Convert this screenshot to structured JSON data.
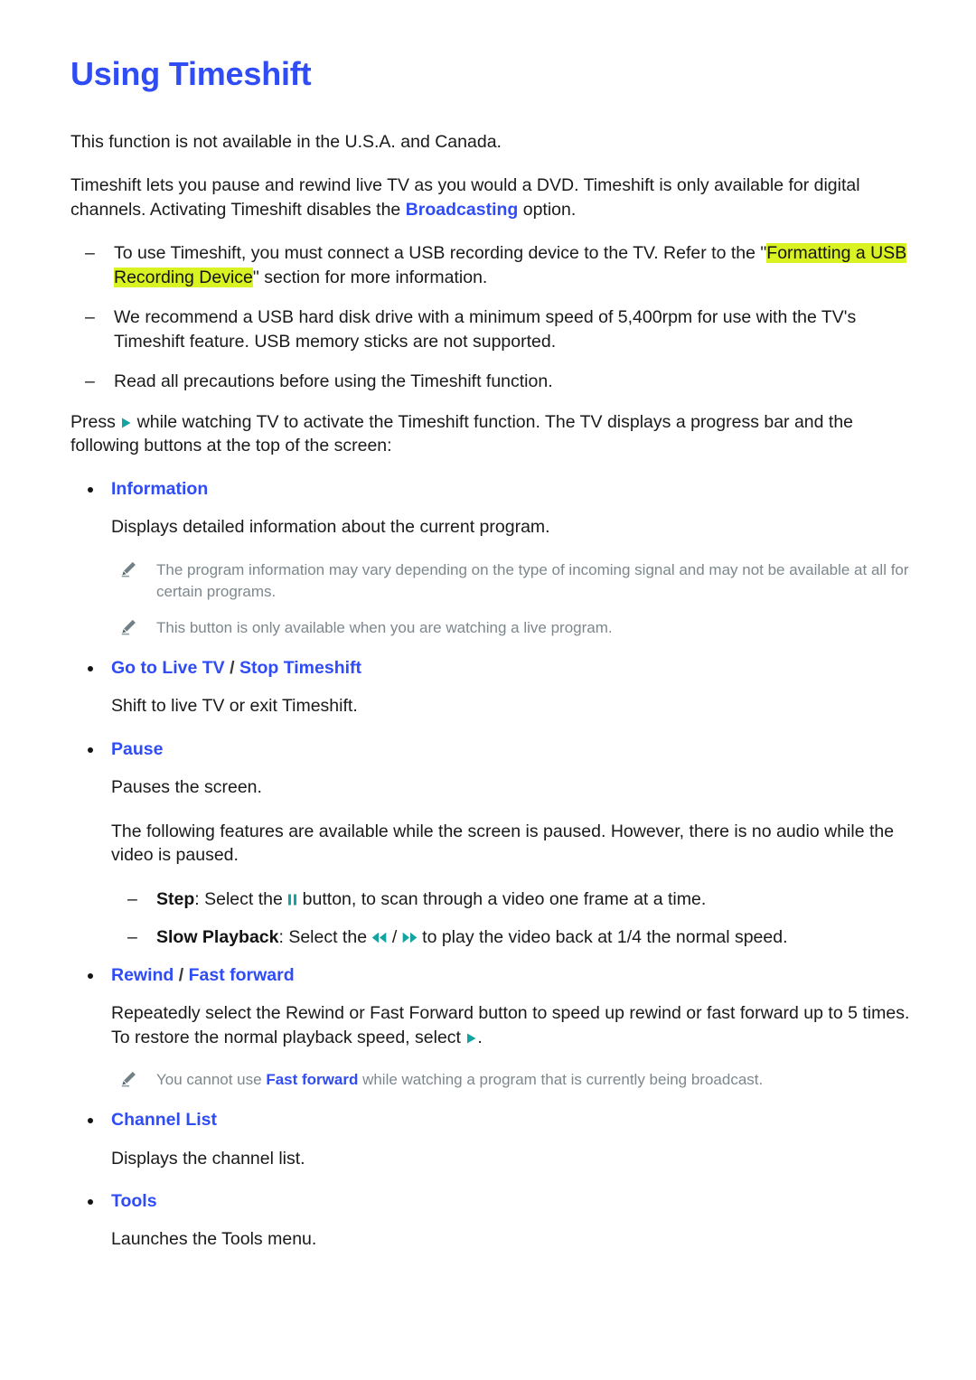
{
  "document": {
    "title": "Using Timeshift"
  },
  "intro": {
    "availability": "This function is not available in the U.S.A. and Canada.",
    "overview_a": "Timeshift lets you pause and rewind live TV as you would a DVD. Timeshift is only available for digital channels. Activating Timeshift disables the ",
    "overview_link": "Broadcasting",
    "overview_b": " option."
  },
  "requirements": [
    {
      "text_a": "To use Timeshift, you must connect a USB recording device to the TV. Refer to the \"",
      "highlight": "Formatting a USB Recording Device",
      "text_b": "\" section for more information."
    },
    {
      "text_a": "We recommend a USB hard disk drive with a minimum speed of 5,400rpm for use with the TV's Timeshift feature. USB memory sticks are not supported.",
      "highlight": "",
      "text_b": ""
    },
    {
      "text_a": "Read all precautions before using the Timeshift function.",
      "highlight": "",
      "text_b": ""
    }
  ],
  "activation": {
    "text_a": "Press ",
    "glyph": "play-icon",
    "text_b": " while watching TV to activate the Timeshift function. The TV displays a progress bar and the following buttons at the top of the screen:"
  },
  "buttons": {
    "information": {
      "label": "Information",
      "description": "Displays detailed information about the current program.",
      "notes": [
        "The program information may vary depending on the type of incoming signal and may not be available at all for certain programs.",
        "This button is only available when you are watching a live program."
      ]
    },
    "go_to_live_tv": {
      "label_a": "Go to Live TV",
      "separator": " / ",
      "label_b": "Stop Timeshift",
      "description": "Shift to live TV or exit Timeshift."
    },
    "pause": {
      "label": "Pause",
      "description": "Pauses the screen.",
      "paused_features_note": "The following features are available while the screen is paused. However, there is no audio while the video is paused.",
      "sub_items": [
        {
          "term": "Step",
          "text_a": ": Select the ",
          "glyph": "pause-icon",
          "text_b": " button, to scan through a video one frame at a time."
        },
        {
          "term": "Slow Playback",
          "text_a": ": Select the ",
          "glyph": "rewind-icon",
          "glyph_sep": " / ",
          "glyph2": "fast-forward-icon",
          "text_b": " to play the video back at 1/4 the normal speed."
        }
      ]
    },
    "rewind_fast_forward": {
      "label_a": "Rewind",
      "separator": " / ",
      "label_b": "Fast forward",
      "description_a": "Repeatedly select the Rewind or Fast Forward button to speed up rewind or fast forward up to 5 times. To restore the normal playback speed, select ",
      "description_glyph": "play-icon",
      "description_b": ".",
      "note_a": "You cannot use ",
      "note_link": "Fast forward",
      "note_b": " while watching a program that is currently being broadcast."
    },
    "channel_list": {
      "label": "Channel List",
      "description": "Displays the channel list."
    },
    "tools": {
      "label": "Tools",
      "description": "Launches the Tools menu."
    }
  },
  "colors": {
    "link_blue": "#2f4cf5",
    "highlight_yellow_green": "#d9f222",
    "note_gray": "#7d878c",
    "glyph_teal": "#13a3a0",
    "body_text": "#1a1a1a"
  }
}
